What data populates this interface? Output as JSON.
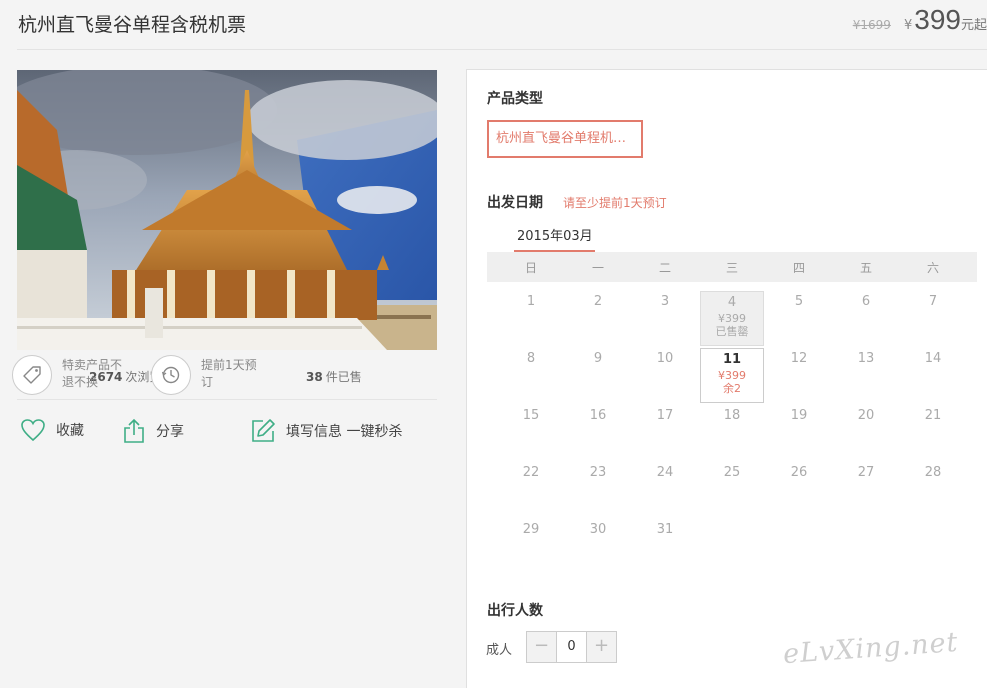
{
  "product": {
    "title": "杭州直飞曼谷单程含税机票",
    "old_price": "¥1699",
    "currency": "¥",
    "price": "399",
    "unit": "元起"
  },
  "stats": {
    "views_count": "2674",
    "views_label": "次浏览",
    "sold_count": "38",
    "sold_label": "件已售"
  },
  "features": [
    {
      "icon": "tag-icon",
      "text_line1": "特卖产品不",
      "text_line2": "退不换"
    },
    {
      "icon": "clock-icon",
      "text_line1": "提前1天预",
      "text_line2": "订"
    }
  ],
  "actions": {
    "favorite": "收藏",
    "share": "分享",
    "book": "填写信息 一键秒杀"
  },
  "booking": {
    "product_type_label": "产品类型",
    "product_type_option": "杭州直飞曼谷单程机…",
    "departure_label": "出发日期",
    "departure_note": "请至少提前1天预订",
    "month": "2015年03月",
    "weekdays": [
      "日",
      "一",
      "二",
      "三",
      "四",
      "五",
      "六"
    ],
    "days": [
      {
        "day": "1"
      },
      {
        "day": "2"
      },
      {
        "day": "3"
      },
      {
        "day": "4",
        "price": "¥399",
        "status": "已售罄"
      },
      {
        "day": "5"
      },
      {
        "day": "6"
      },
      {
        "day": "7"
      },
      {
        "day": "8"
      },
      {
        "day": "9"
      },
      {
        "day": "10"
      },
      {
        "day": "11",
        "price": "¥399",
        "status": "余2"
      },
      {
        "day": "12"
      },
      {
        "day": "13"
      },
      {
        "day": "14"
      },
      {
        "day": "15"
      },
      {
        "day": "16"
      },
      {
        "day": "17"
      },
      {
        "day": "18"
      },
      {
        "day": "19"
      },
      {
        "day": "20"
      },
      {
        "day": "21"
      },
      {
        "day": "22"
      },
      {
        "day": "23"
      },
      {
        "day": "24"
      },
      {
        "day": "25"
      },
      {
        "day": "26"
      },
      {
        "day": "27"
      },
      {
        "day": "28"
      },
      {
        "day": "29"
      },
      {
        "day": "30"
      },
      {
        "day": "31"
      }
    ],
    "travelers_label": "出行人数",
    "adult_label": "成人",
    "minus": "−",
    "adult_count": "0",
    "plus": "+"
  },
  "watermark": "eLvXing.net",
  "colors": {
    "accent": "#e27b6c",
    "icon_green": "#3fae86"
  }
}
